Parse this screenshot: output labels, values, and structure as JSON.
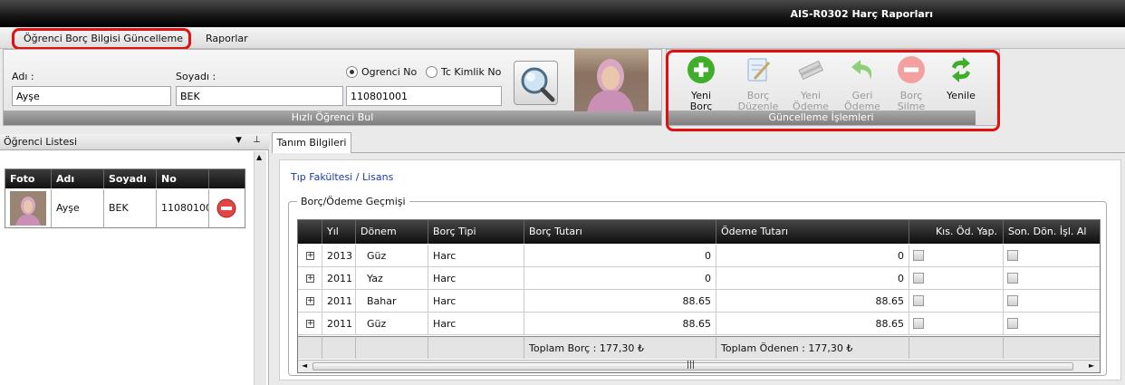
{
  "window": {
    "title": "AIS-R0302 Harç Raporları"
  },
  "menu": {
    "items": [
      "Öğrenci Borç Bilgisi Güncelleme",
      "Raporlar"
    ]
  },
  "search": {
    "ad_label": "Adı :",
    "ad_value": "Ayşe",
    "soyad_label": "Soyadı :",
    "soyad_value": "BEK",
    "radio_ogrenci": "Ogrenci No",
    "radio_tc": "Tc Kimlik No",
    "no_value": "110801001",
    "footer": "Hızlı Öğrenci Bul"
  },
  "toolbar": {
    "footer": "Güncelleme İşlemleri",
    "buttons": [
      {
        "l1": "Yeni",
        "l2": "Borç",
        "icon": "add-icon",
        "color": "#3fae2a"
      },
      {
        "l1": "Borç",
        "l2": "Düzenle",
        "icon": "edit-icon",
        "color": "#8fb0d6"
      },
      {
        "l1": "Yeni",
        "l2": "Ödeme",
        "icon": "money-icon",
        "color": "#a5a5a5"
      },
      {
        "l1": "Geri",
        "l2": "Ödeme",
        "icon": "undo-icon",
        "color": "#8fcf7a"
      },
      {
        "l1": "Borç",
        "l2": "Silme",
        "icon": "remove-icon",
        "color": "#f2a0a0"
      },
      {
        "l1": "Yenile",
        "l2": "",
        "icon": "refresh-icon",
        "color": "#3fae2a"
      }
    ]
  },
  "left": {
    "title": "Öğrenci Listesi",
    "columns": [
      "Foto",
      "Adı",
      "Soyadı",
      "No"
    ],
    "row": {
      "ad": "Ayşe",
      "soyad": "BEK",
      "no": "11080100"
    }
  },
  "tabs": [
    "Tanım Bilgileri"
  ],
  "detail": {
    "program": "Tıp Fakültesi / Lisans",
    "group_title": "Borç/Ödeme Geçmişi"
  },
  "grid": {
    "columns": [
      "Yıl",
      "Dönem",
      "Borç Tipi",
      "Borç Tutarı",
      "Ödeme Tutarı",
      "Kıs. Öd. Yap.",
      "Son. Dön. İşl. Al"
    ],
    "rows": [
      {
        "yil": "2013",
        "donem": "Güz",
        "tip": "Harc",
        "borc": "0",
        "odeme": "0"
      },
      {
        "yil": "2011",
        "donem": "Yaz",
        "tip": "Harc",
        "borc": "0",
        "odeme": "0"
      },
      {
        "yil": "2011",
        "donem": "Bahar",
        "tip": "Harc",
        "borc": "88.65",
        "odeme": "88.65"
      },
      {
        "yil": "2011",
        "donem": "Güz",
        "tip": "Harc",
        "borc": "88.65",
        "odeme": "88.65"
      }
    ],
    "footer": {
      "borc": "Toplam Borç : 177,30 ₺",
      "odeme": "Toplam Ödenen : 177,30 ₺"
    }
  }
}
